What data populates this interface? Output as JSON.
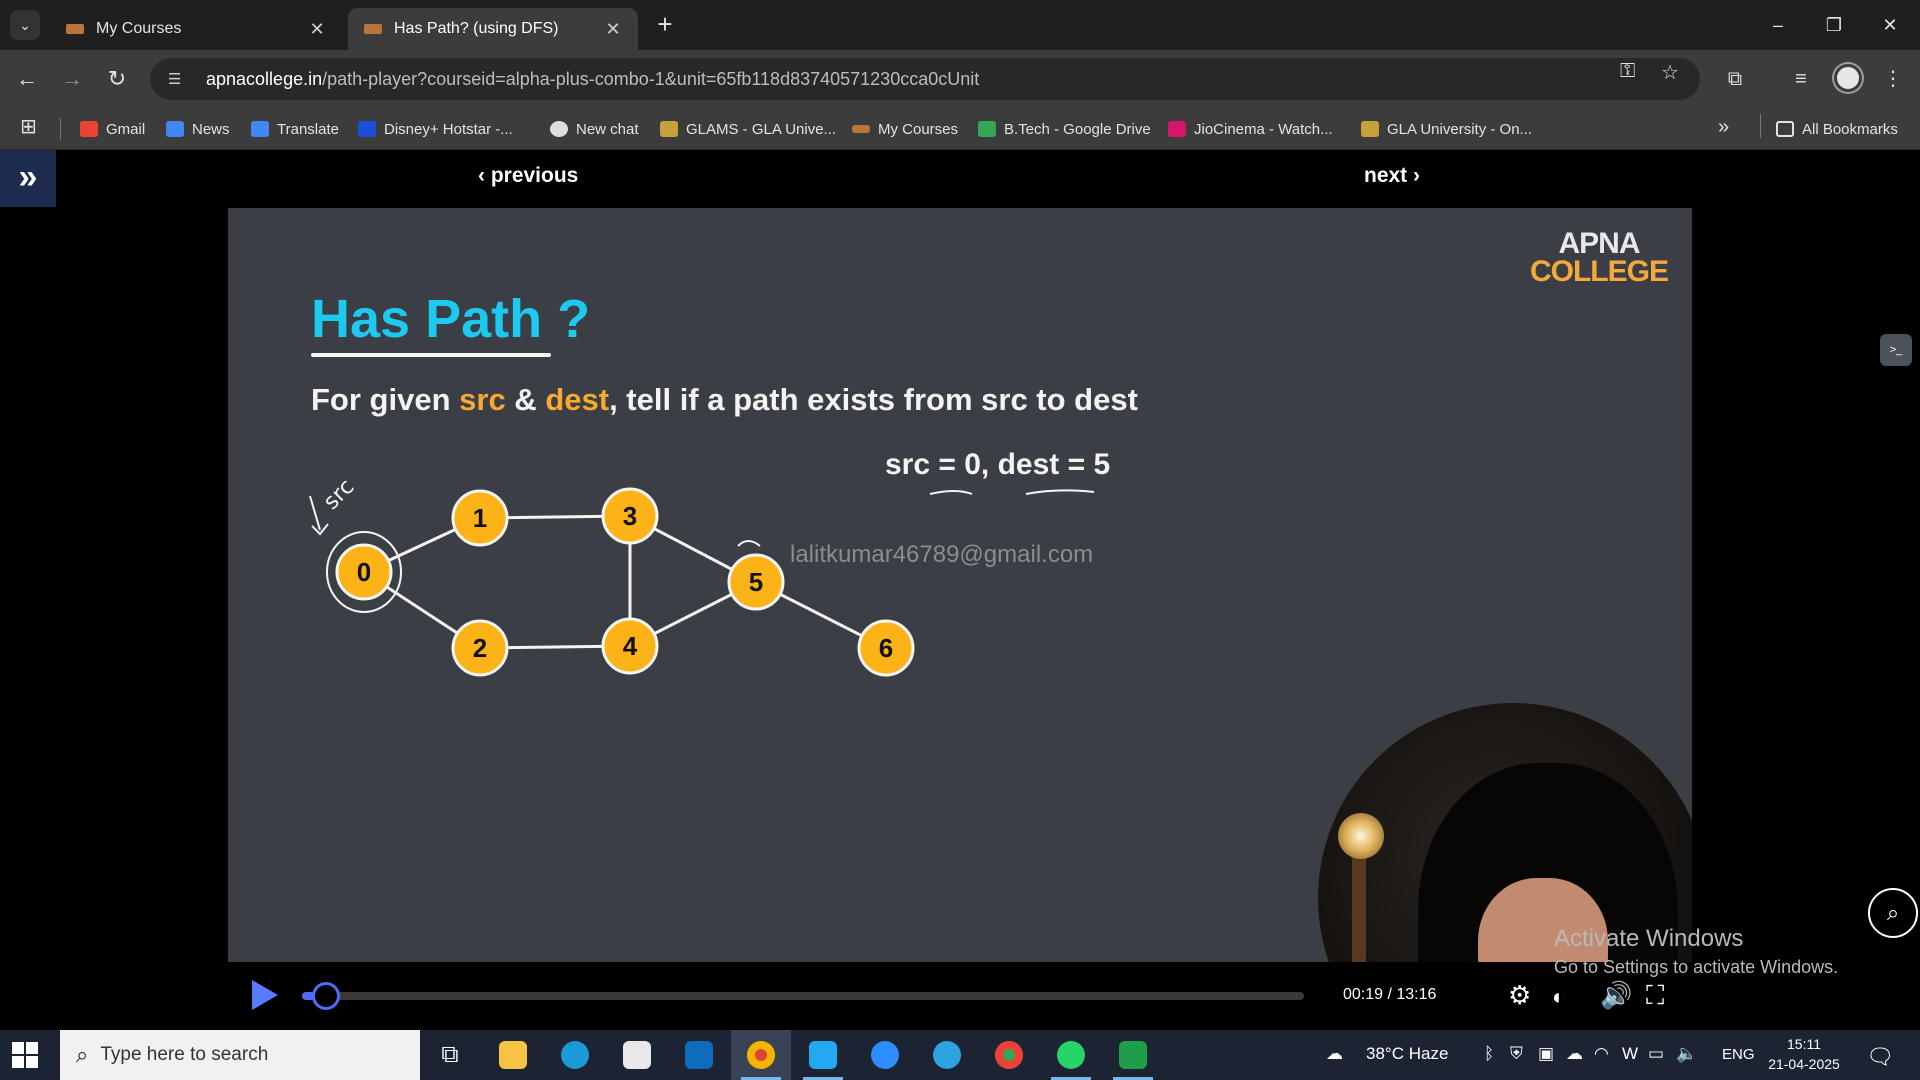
{
  "browser": {
    "tabs": [
      {
        "title": "My Courses",
        "active": false
      },
      {
        "title": "Has Path? (using DFS)",
        "active": true
      }
    ],
    "url_host": "apnacollege.in",
    "url_path": "/path-player?courseid=alpha-plus-combo-1&unit=65fb118d83740571230cca0cUnit",
    "bookmarks": [
      {
        "label": "Gmail",
        "color": "#ea4335"
      },
      {
        "label": "News",
        "color": "#4285f4"
      },
      {
        "label": "Translate",
        "color": "#4285f4"
      },
      {
        "label": "Disney+ Hotstar -...",
        "color": "#1b4fd8"
      },
      {
        "label": "New chat",
        "color": "#dddddd"
      },
      {
        "label": "GLAMS - GLA Unive...",
        "color": "#c7a23a"
      },
      {
        "label": "My Courses",
        "color": "#b9763c"
      },
      {
        "label": "B.Tech - Google Drive",
        "color": "#34a853"
      },
      {
        "label": "JioCinema - Watch...",
        "color": "#d6156c"
      },
      {
        "label": "GLA University - On...",
        "color": "#c7a23a"
      }
    ],
    "all_bookmarks": "All Bookmarks"
  },
  "player": {
    "previous": "previous",
    "next": "next",
    "time": "00:19 / 13:16",
    "progress": 0.024
  },
  "slide": {
    "logo_line1": "APNA",
    "logo_line2": "COLLEGE",
    "title": "Has Path ?",
    "problem_part1": "For given ",
    "problem_src": "src",
    "problem_part2": " & ",
    "problem_dest": "dest",
    "problem_part3": ", tell if a path exists from src to dest",
    "params": "src = 0, dest = 5",
    "annotation": "src",
    "watermark": "lalitkumar46789@gmail.com",
    "node_color": "#fbb318",
    "nodes": [
      "0",
      "1",
      "2",
      "3",
      "4",
      "5",
      "6"
    ]
  },
  "os": {
    "activate_title": "Activate Windows",
    "activate_sub": "Go to Settings to activate Windows.",
    "search_placeholder": "Type here to search",
    "weather": "38°C  Haze",
    "lang": "ENG",
    "clock_time": "15:11",
    "clock_date": "21-04-2025"
  }
}
